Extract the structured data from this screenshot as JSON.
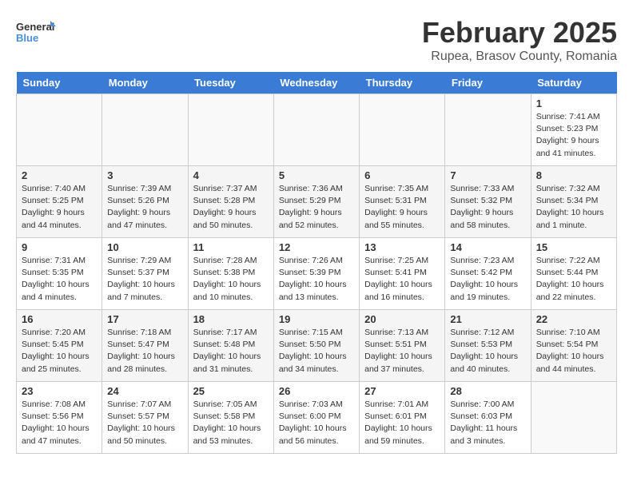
{
  "logo": {
    "text_general": "General",
    "text_blue": "Blue"
  },
  "header": {
    "month": "February 2025",
    "location": "Rupea, Brasov County, Romania"
  },
  "weekdays": [
    "Sunday",
    "Monday",
    "Tuesday",
    "Wednesday",
    "Thursday",
    "Friday",
    "Saturday"
  ],
  "weeks": [
    [
      {
        "day": "",
        "info": ""
      },
      {
        "day": "",
        "info": ""
      },
      {
        "day": "",
        "info": ""
      },
      {
        "day": "",
        "info": ""
      },
      {
        "day": "",
        "info": ""
      },
      {
        "day": "",
        "info": ""
      },
      {
        "day": "1",
        "info": "Sunrise: 7:41 AM\nSunset: 5:23 PM\nDaylight: 9 hours and 41 minutes."
      }
    ],
    [
      {
        "day": "2",
        "info": "Sunrise: 7:40 AM\nSunset: 5:25 PM\nDaylight: 9 hours and 44 minutes."
      },
      {
        "day": "3",
        "info": "Sunrise: 7:39 AM\nSunset: 5:26 PM\nDaylight: 9 hours and 47 minutes."
      },
      {
        "day": "4",
        "info": "Sunrise: 7:37 AM\nSunset: 5:28 PM\nDaylight: 9 hours and 50 minutes."
      },
      {
        "day": "5",
        "info": "Sunrise: 7:36 AM\nSunset: 5:29 PM\nDaylight: 9 hours and 52 minutes."
      },
      {
        "day": "6",
        "info": "Sunrise: 7:35 AM\nSunset: 5:31 PM\nDaylight: 9 hours and 55 minutes."
      },
      {
        "day": "7",
        "info": "Sunrise: 7:33 AM\nSunset: 5:32 PM\nDaylight: 9 hours and 58 minutes."
      },
      {
        "day": "8",
        "info": "Sunrise: 7:32 AM\nSunset: 5:34 PM\nDaylight: 10 hours and 1 minute."
      }
    ],
    [
      {
        "day": "9",
        "info": "Sunrise: 7:31 AM\nSunset: 5:35 PM\nDaylight: 10 hours and 4 minutes."
      },
      {
        "day": "10",
        "info": "Sunrise: 7:29 AM\nSunset: 5:37 PM\nDaylight: 10 hours and 7 minutes."
      },
      {
        "day": "11",
        "info": "Sunrise: 7:28 AM\nSunset: 5:38 PM\nDaylight: 10 hours and 10 minutes."
      },
      {
        "day": "12",
        "info": "Sunrise: 7:26 AM\nSunset: 5:39 PM\nDaylight: 10 hours and 13 minutes."
      },
      {
        "day": "13",
        "info": "Sunrise: 7:25 AM\nSunset: 5:41 PM\nDaylight: 10 hours and 16 minutes."
      },
      {
        "day": "14",
        "info": "Sunrise: 7:23 AM\nSunset: 5:42 PM\nDaylight: 10 hours and 19 minutes."
      },
      {
        "day": "15",
        "info": "Sunrise: 7:22 AM\nSunset: 5:44 PM\nDaylight: 10 hours and 22 minutes."
      }
    ],
    [
      {
        "day": "16",
        "info": "Sunrise: 7:20 AM\nSunset: 5:45 PM\nDaylight: 10 hours and 25 minutes."
      },
      {
        "day": "17",
        "info": "Sunrise: 7:18 AM\nSunset: 5:47 PM\nDaylight: 10 hours and 28 minutes."
      },
      {
        "day": "18",
        "info": "Sunrise: 7:17 AM\nSunset: 5:48 PM\nDaylight: 10 hours and 31 minutes."
      },
      {
        "day": "19",
        "info": "Sunrise: 7:15 AM\nSunset: 5:50 PM\nDaylight: 10 hours and 34 minutes."
      },
      {
        "day": "20",
        "info": "Sunrise: 7:13 AM\nSunset: 5:51 PM\nDaylight: 10 hours and 37 minutes."
      },
      {
        "day": "21",
        "info": "Sunrise: 7:12 AM\nSunset: 5:53 PM\nDaylight: 10 hours and 40 minutes."
      },
      {
        "day": "22",
        "info": "Sunrise: 7:10 AM\nSunset: 5:54 PM\nDaylight: 10 hours and 44 minutes."
      }
    ],
    [
      {
        "day": "23",
        "info": "Sunrise: 7:08 AM\nSunset: 5:56 PM\nDaylight: 10 hours and 47 minutes."
      },
      {
        "day": "24",
        "info": "Sunrise: 7:07 AM\nSunset: 5:57 PM\nDaylight: 10 hours and 50 minutes."
      },
      {
        "day": "25",
        "info": "Sunrise: 7:05 AM\nSunset: 5:58 PM\nDaylight: 10 hours and 53 minutes."
      },
      {
        "day": "26",
        "info": "Sunrise: 7:03 AM\nSunset: 6:00 PM\nDaylight: 10 hours and 56 minutes."
      },
      {
        "day": "27",
        "info": "Sunrise: 7:01 AM\nSunset: 6:01 PM\nDaylight: 10 hours and 59 minutes."
      },
      {
        "day": "28",
        "info": "Sunrise: 7:00 AM\nSunset: 6:03 PM\nDaylight: 11 hours and 3 minutes."
      },
      {
        "day": "",
        "info": ""
      }
    ]
  ]
}
